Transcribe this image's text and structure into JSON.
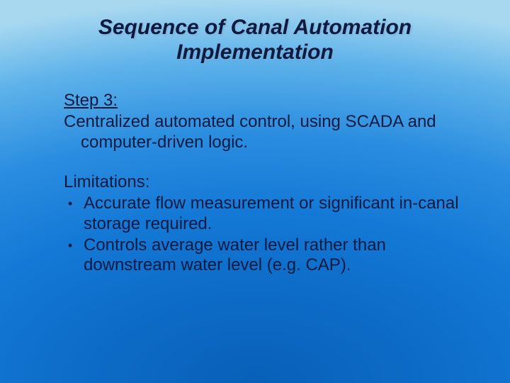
{
  "title": "Sequence of Canal Automation Implementation",
  "step": {
    "label": "Step 3:",
    "description": "Centralized automated control, using SCADA and computer-driven logic."
  },
  "limitations": {
    "label": "Limitations:",
    "items": [
      "Accurate flow measurement or significant in-canal storage required.",
      "Controls average water level rather than downstream water level (e.g. CAP)."
    ]
  }
}
